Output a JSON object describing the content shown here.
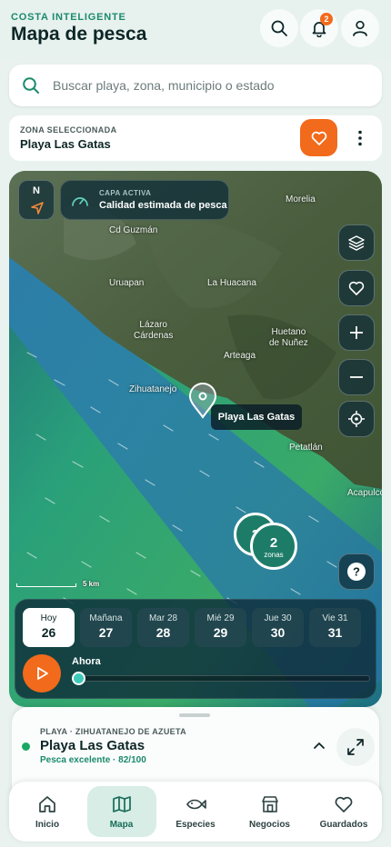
{
  "header": {
    "brand": "COSTA INTELIGENTE",
    "title": "Mapa de pesca",
    "notification_count": "2"
  },
  "search": {
    "placeholder": "Buscar playa, zona, municipio o estado"
  },
  "zone": {
    "label": "ZONA SELECCIONADA",
    "name": "Playa Las Gatas"
  },
  "map": {
    "compass": "N",
    "layer_kicker": "CAPA ACTIVA",
    "layer_name": "Calidad estimada de pesca",
    "places": {
      "morelia": "Morelia",
      "cd_guzman": "Cd Guzmán",
      "uruapan": "Uruapan",
      "la_huacana": "La Huacana",
      "lazaro": "Lázaro\nCárdenas",
      "huetano": "Huetano\nde Nuñez",
      "arteaga": "Arteaga",
      "zihuatanejo": "Zihuatanejo",
      "petatlan": "Petatlán",
      "acapulco": "Acapulco"
    },
    "callout": "Playa Las Gatas",
    "cluster_back": "2",
    "cluster_count": "2",
    "cluster_label": "zonas",
    "scale": "5 km",
    "help": "?"
  },
  "timeline": {
    "days": [
      {
        "name": "Hoy",
        "num": "26"
      },
      {
        "name": "Mañana",
        "num": "27"
      },
      {
        "name": "Mar 28",
        "num": "28"
      },
      {
        "name": "Mié 29",
        "num": "29"
      },
      {
        "name": "Jue 30",
        "num": "30"
      },
      {
        "name": "Vie 31",
        "num": "31"
      }
    ],
    "now_label": "Ahora",
    "progress": 0
  },
  "sheet": {
    "kicker": "PLAYA · ZIHUATANEJO DE AZUETA",
    "name": "Playa Las Gatas",
    "score": "Pesca excelente · 82/100"
  },
  "nav": {
    "items": [
      {
        "label": "Inicio",
        "icon": "home-icon"
      },
      {
        "label": "Mapa",
        "icon": "map-icon"
      },
      {
        "label": "Especies",
        "icon": "fish-icon"
      },
      {
        "label": "Negocios",
        "icon": "store-icon"
      },
      {
        "label": "Guardados",
        "icon": "heart-icon"
      }
    ],
    "active": "Mapa"
  },
  "colors": {
    "accent": "#1a8a6a",
    "orange": "#f26a1b",
    "active_nav": "#d7ede6"
  }
}
